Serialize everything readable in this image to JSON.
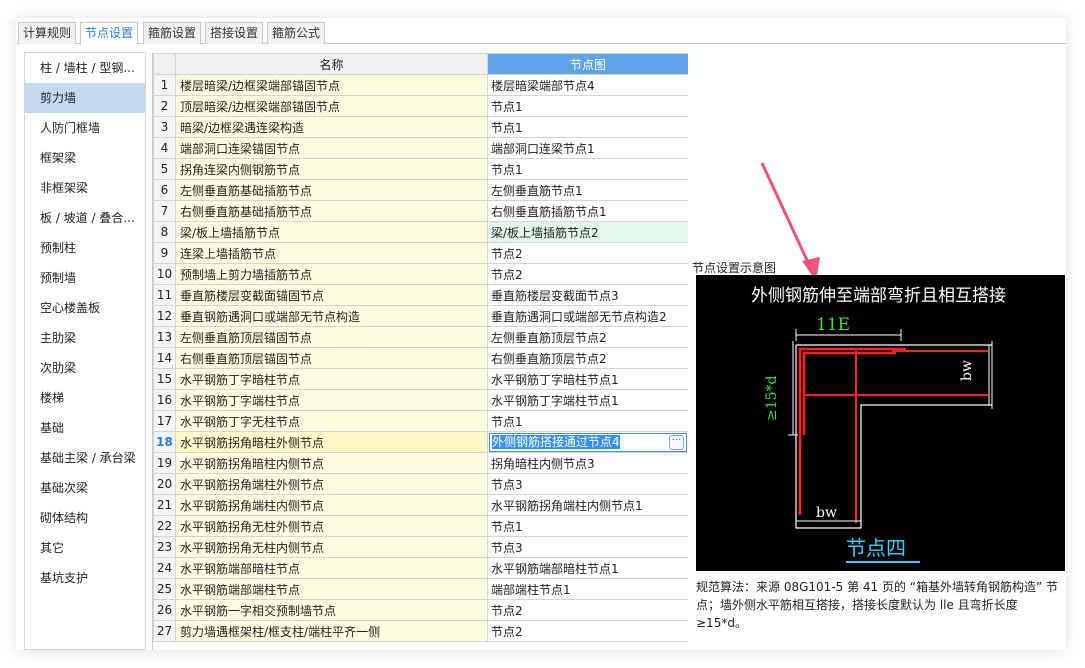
{
  "tabs": [
    {
      "label": "计算规则",
      "active": false
    },
    {
      "label": "节点设置",
      "active": true
    },
    {
      "label": "箍筋设置",
      "active": false
    },
    {
      "label": "搭接设置",
      "active": false
    },
    {
      "label": "箍筋公式",
      "active": false
    }
  ],
  "sidebar": {
    "selected_index": 1,
    "items": [
      {
        "label": "柱 / 墙柱 / 型钢..."
      },
      {
        "label": "剪力墙"
      },
      {
        "label": "人防门框墙"
      },
      {
        "label": "框架梁"
      },
      {
        "label": "非框架梁"
      },
      {
        "label": "板 / 坡道 / 叠合..."
      },
      {
        "label": "预制柱"
      },
      {
        "label": "预制墙"
      },
      {
        "label": "空心楼盖板"
      },
      {
        "label": "主肋梁"
      },
      {
        "label": "次肋梁"
      },
      {
        "label": "楼梯"
      },
      {
        "label": "基础"
      },
      {
        "label": "基础主梁 / 承台梁"
      },
      {
        "label": "基础次梁"
      },
      {
        "label": "砌体结构"
      },
      {
        "label": "其它"
      },
      {
        "label": "基坑支护"
      }
    ]
  },
  "table": {
    "headers": {
      "name": "名称",
      "node": "节点图"
    },
    "selected_row": 18,
    "rows": [
      {
        "num": "1",
        "name": "楼层暗梁/边框梁端部锚固节点",
        "node": "楼层暗梁端部节点4"
      },
      {
        "num": "2",
        "name": "顶层暗梁/边框梁端部锚固节点",
        "node": "节点1"
      },
      {
        "num": "3",
        "name": "暗梁/边框梁遇连梁构造",
        "node": "节点1"
      },
      {
        "num": "4",
        "name": "端部洞口连梁锚固节点",
        "node": "端部洞口连梁节点1"
      },
      {
        "num": "5",
        "name": "拐角连梁内侧钢筋节点",
        "node": "节点1"
      },
      {
        "num": "6",
        "name": "左侧垂直筋基础插筋节点",
        "node": "左侧垂直筋节点1"
      },
      {
        "num": "7",
        "name": "右侧垂直筋基础插筋节点",
        "node": "右侧垂直筋插筋节点1"
      },
      {
        "num": "8",
        "name": "梁/板上墙插筋节点",
        "node": "梁/板上墙插筋节点2"
      },
      {
        "num": "9",
        "name": "连梁上墙插筋节点",
        "node": "节点2"
      },
      {
        "num": "10",
        "name": "预制墙上剪力墙插筋节点",
        "node": "节点2"
      },
      {
        "num": "11",
        "name": "垂直筋楼层变截面锚固节点",
        "node": "垂直筋楼层变截面节点3"
      },
      {
        "num": "12",
        "name": "垂直钢筋遇洞口或端部无节点构造",
        "node": "垂直筋遇洞口或端部无节点构造2"
      },
      {
        "num": "13",
        "name": "左侧垂直筋顶层锚固节点",
        "node": "左侧垂直筋顶层节点2"
      },
      {
        "num": "14",
        "name": "右侧垂直筋顶层锚固节点",
        "node": "右侧垂直筋顶层节点2"
      },
      {
        "num": "15",
        "name": "水平钢筋丁字暗柱节点",
        "node": "水平钢筋丁字暗柱节点1"
      },
      {
        "num": "16",
        "name": "水平钢筋丁字端柱节点",
        "node": "水平钢筋丁字端柱节点1"
      },
      {
        "num": "17",
        "name": "水平钢筋丁字无柱节点",
        "node": "节点1"
      },
      {
        "num": "18",
        "name": "水平钢筋拐角暗柱外侧节点",
        "node": "外侧钢筋搭接通过节点4"
      },
      {
        "num": "19",
        "name": "水平钢筋拐角暗柱内侧节点",
        "node": "拐角暗柱内侧节点3"
      },
      {
        "num": "20",
        "name": "水平钢筋拐角端柱外侧节点",
        "node": "节点3"
      },
      {
        "num": "21",
        "name": "水平钢筋拐角端柱内侧节点",
        "node": "水平钢筋拐角端柱内侧节点1"
      },
      {
        "num": "22",
        "name": "水平钢筋拐角无柱外侧节点",
        "node": "节点1"
      },
      {
        "num": "23",
        "name": "水平钢筋拐角无柱内侧节点",
        "node": "节点3"
      },
      {
        "num": "24",
        "name": "水平钢筋端部暗柱节点",
        "node": "水平钢筋端部暗柱节点1"
      },
      {
        "num": "25",
        "name": "水平钢筋端部端柱节点",
        "node": "端部端柱节点1"
      },
      {
        "num": "26",
        "name": "水平钢筋一字相交预制墙节点",
        "node": "节点2"
      },
      {
        "num": "27",
        "name": "剪力墙遇框架柱/框支柱/端柱平齐一侧",
        "node": "节点2"
      }
    ]
  },
  "diagram": {
    "panel_title": "节点设置示意图",
    "heading": "外侧钢筋伸至端部弯折且相互搭接",
    "label_top": "11E",
    "label_left": "≥15*d",
    "label_bw_right": "bw",
    "label_bw_bottom": "bw",
    "caption": "节点四",
    "colors": {
      "background": "#000000",
      "rebar": "#ff2020",
      "outline": "#ffffff",
      "dimension_green": "#3ce03c",
      "caption_cyan": "#2fd0ff",
      "pointer_arrow": "#f0507a"
    }
  },
  "description": "规范算法：来源 08G101-5 第 41 页的 “箱基外墙转角钢筋构造” 节点；墙外侧水平筋相互搭接，搭接长度默认为 lle 且弯折长度 ≥15*d。"
}
